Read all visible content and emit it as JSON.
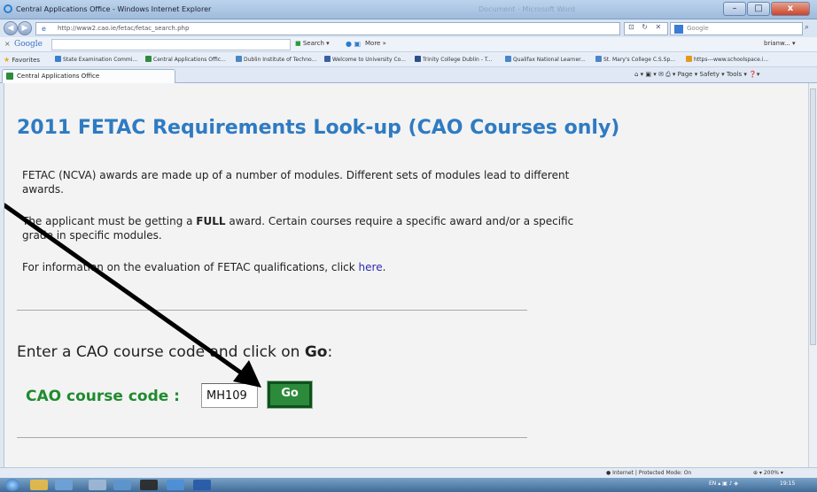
{
  "window": {
    "title": "Central Applications Office - Windows Internet Explorer",
    "background_title": "Document - Microsoft Word",
    "minimize": "–",
    "maximize": "□",
    "close": "x"
  },
  "address_bar": {
    "url": "http://www2.cao.ie/fetac/fetac_search.php",
    "controls": "⊡ ↻ ✕",
    "search_placeholder": "Google"
  },
  "google_toolbar": {
    "close": "×",
    "logo": "Google",
    "search_label": "Search ▾",
    "more_label": "More »",
    "user_label": "brianw... ▾"
  },
  "favorites_bar": {
    "label": "Favorites",
    "items": [
      "State Examination Commi...",
      "Central Applications Offic...",
      "Dublin Institute of Techno...",
      "Welcome to University Co...",
      "Trinity College Dublin - T...",
      "Qualifax National Learner...",
      "St. Mary's College C.S.Sp...",
      "https---www.schoolspace.i..."
    ]
  },
  "tab": {
    "label": "Central Applications Office"
  },
  "command_bar": {
    "text": "Page ▾  Safety ▾  Tools ▾"
  },
  "page": {
    "heading": "2011 FETAC Requirements Look-up (CAO Courses only)",
    "para1": "FETAC (NCVA) awards are made up of a number of modules. Different sets of modules lead to different awards.",
    "para2_before": "The applicant must be getting a ",
    "para2_bold": "FULL",
    "para2_after": " award. Certain courses require a specific award and/or a specific grade in specific modules.",
    "para3_before": "For information on the evaluation of FETAC qualifications, click ",
    "para3_link": "here",
    "para3_after": ".",
    "enter_before": "Enter a CAO course code and click on ",
    "enter_bold": "Go",
    "enter_after": ":",
    "code_label": "CAO course code :",
    "code_value": "MH109",
    "go_button": "Go"
  },
  "status_bar": {
    "protected_mode": "Internet | Protected Mode: On",
    "zoom": "200%"
  },
  "taskbar": {
    "clock": "19:15",
    "tray": "EN"
  },
  "colors": {
    "heading": "#2f7bc2",
    "label_green": "#1f8b2e",
    "go_button": "#2c8a3b",
    "link": "#2d2bb5"
  }
}
